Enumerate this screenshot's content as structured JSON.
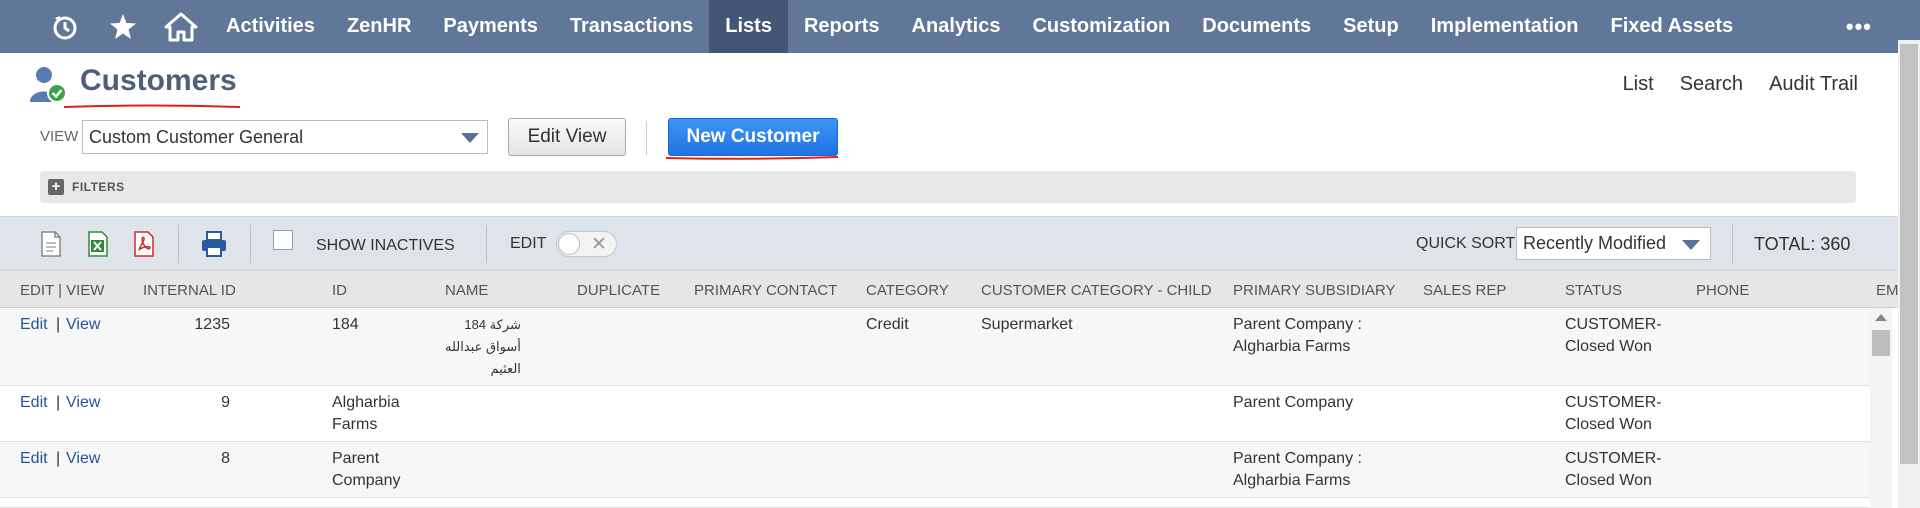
{
  "nav": {
    "icons": [
      "recent-icon",
      "star-icon",
      "home-icon"
    ],
    "items": [
      "Activities",
      "ZenHR",
      "Payments",
      "Transactions",
      "Lists",
      "Reports",
      "Analytics",
      "Customization",
      "Documents",
      "Setup",
      "Implementation",
      "Fixed Assets"
    ],
    "active": "Lists",
    "more": "•••"
  },
  "header": {
    "title": "Customers",
    "links": [
      "List",
      "Search",
      "Audit Trail"
    ]
  },
  "view": {
    "label": "VIEW",
    "selected": "Custom Customer General",
    "edit_view": "Edit View",
    "new_customer": "New Customer"
  },
  "filters": {
    "label": "FILTERS"
  },
  "toolbar": {
    "show_inactives": "SHOW INACTIVES",
    "edit": "EDIT",
    "quick_sort_label": "QUICK SORT",
    "quick_sort_value": "Recently Modified",
    "total": "TOTAL: 360"
  },
  "table": {
    "columns": [
      "EDIT | VIEW",
      "INTERNAL ID",
      "ID",
      "NAME",
      "DUPLICATE",
      "PRIMARY CONTACT",
      "CATEGORY",
      "CUSTOMER CATEGORY - CHILD",
      "PRIMARY SUBSIDIARY",
      "SALES REP",
      "STATUS",
      "PHONE",
      "EM"
    ],
    "edit": "Edit",
    "sep": "|",
    "view": "View",
    "rows": [
      {
        "internal_id": "1235",
        "id": "184",
        "name_l1": "شركة 184",
        "name_l2": "أسواق عبدالله",
        "name_l3": "العثيم",
        "category": "Credit",
        "child": "Supermarket",
        "sub_l1": "Parent Company :",
        "sub_l2": "Algharbia Farms",
        "status_l1": "CUSTOMER-",
        "status_l2": "Closed Won"
      },
      {
        "internal_id": "9",
        "id_l1": "Algharbia",
        "id_l2": "Farms",
        "sub_l1": "Parent Company",
        "status_l1": "CUSTOMER-",
        "status_l2": "Closed Won"
      },
      {
        "internal_id": "8",
        "id_l1": "Parent",
        "id_l2": "Company",
        "sub_l1": "Parent Company :",
        "sub_l2": "Algharbia Farms",
        "status_l1": "CUSTOMER-",
        "status_l2": "Closed Won"
      }
    ]
  },
  "colors": {
    "nav_bg": "#607799",
    "nav_active": "#435676",
    "primary_button": "#2a7fec",
    "link": "#255599",
    "annotation_underline": "#e0201f"
  }
}
